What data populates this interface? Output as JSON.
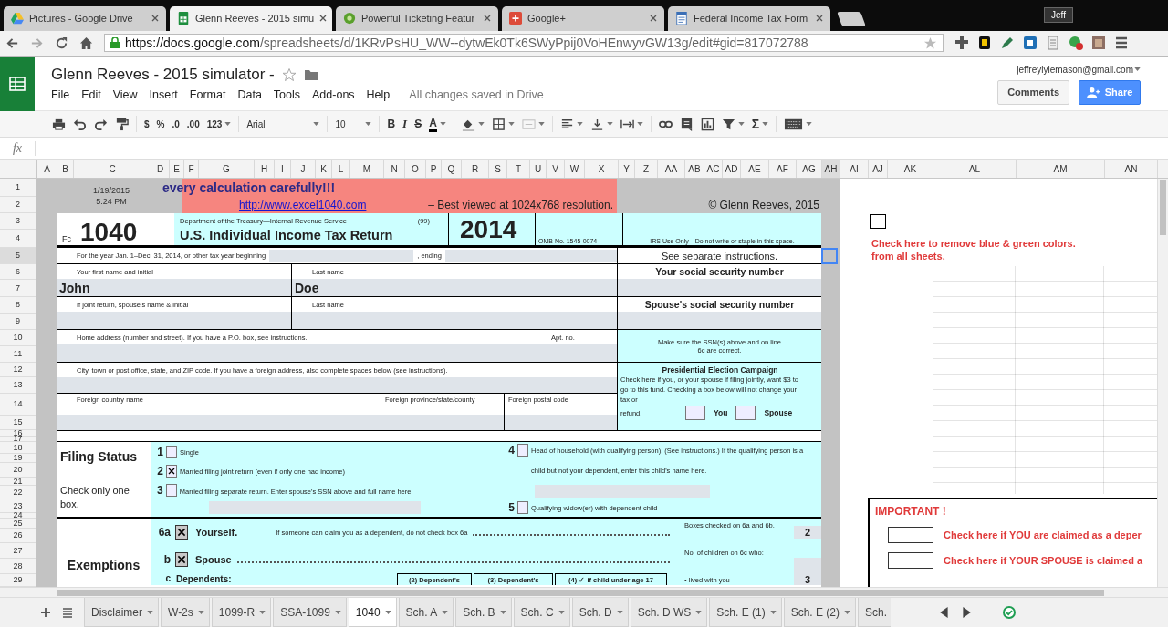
{
  "browser": {
    "tabs": [
      {
        "title": "Pictures - Google Drive",
        "selected": false
      },
      {
        "title": "Glenn Reeves - 2015 simu",
        "selected": true
      },
      {
        "title": "Powerful Ticketing Featur",
        "selected": false
      },
      {
        "title": "Google+",
        "selected": false
      },
      {
        "title": "Federal Income Tax Form",
        "selected": false
      }
    ],
    "profile": "Jeff",
    "url_host": "https://docs.google.com",
    "url_path": "/spreadsheets/d/1KRvPsHU_WW--dytwEk0Tk6SWyPpij0VoHEnwyvGW13g/edit#gid=817072788"
  },
  "docs": {
    "title": "Glenn Reeves - 2015 simulator -",
    "menu": [
      "File",
      "Edit",
      "View",
      "Insert",
      "Format",
      "Data",
      "Tools",
      "Add-ons",
      "Help"
    ],
    "save_status": "All changes saved in Drive",
    "account": "jeffreylylemason@gmail.com",
    "comments": "Comments",
    "share": "Share"
  },
  "toolbar": {
    "currency": "$",
    "percent": "%",
    "decrease_decimals": ".0",
    "increase_decimals": ".00",
    "more_formats": "123",
    "font": "Arial",
    "font_size": "10",
    "bold": "B",
    "italic": "I",
    "strike": "S",
    "text_color": "A",
    "functions": "Σ"
  },
  "formula_bar": {
    "label": "fx"
  },
  "sheet": {
    "columns": [
      {
        "label": "A",
        "selected": false
      },
      {
        "label": "B",
        "selected": false
      },
      {
        "label": "C",
        "selected": false
      },
      {
        "label": "D",
        "selected": false
      },
      {
        "label": "E",
        "selected": false
      },
      {
        "label": "F",
        "selected": false
      },
      {
        "label": "G",
        "selected": false
      },
      {
        "label": "H",
        "selected": false
      },
      {
        "label": "I",
        "selected": false
      },
      {
        "label": "J",
        "selected": false
      },
      {
        "label": "K",
        "selected": false
      },
      {
        "label": "L",
        "selected": false
      },
      {
        "label": "M",
        "selected": false
      },
      {
        "label": "N",
        "selected": false
      },
      {
        "label": "O",
        "selected": false
      },
      {
        "label": "P",
        "selected": false
      },
      {
        "label": "Q",
        "selected": false
      },
      {
        "label": "R",
        "selected": false
      },
      {
        "label": "S",
        "selected": false
      },
      {
        "label": "T",
        "selected": false
      },
      {
        "label": "U",
        "selected": false
      },
      {
        "label": "V",
        "selected": false
      },
      {
        "label": "W",
        "selected": false
      },
      {
        "label": "X",
        "selected": false
      },
      {
        "label": "Y",
        "selected": false
      },
      {
        "label": "Z",
        "selected": false
      },
      {
        "label": "AA",
        "selected": false
      },
      {
        "label": "AB",
        "selected": false
      },
      {
        "label": "AC",
        "selected": false
      },
      {
        "label": "AD",
        "selected": false
      },
      {
        "label": "AE",
        "selected": false
      },
      {
        "label": "AF",
        "selected": false
      },
      {
        "label": "AG",
        "selected": false
      },
      {
        "label": "AH",
        "selected": true
      },
      {
        "label": "AI",
        "selected": false
      },
      {
        "label": "AJ",
        "selected": false
      },
      {
        "label": "AK",
        "selected": false
      },
      {
        "label": "AL",
        "selected": false
      },
      {
        "label": "AM",
        "selected": false
      },
      {
        "label": "AN",
        "selected": false
      }
    ],
    "rows": [
      {
        "label": "1",
        "selected": false
      },
      {
        "label": "2",
        "selected": false
      },
      {
        "label": "3",
        "selected": false
      },
      {
        "label": "4",
        "selected": false
      },
      {
        "label": "5",
        "selected": true
      },
      {
        "label": "6",
        "selected": false
      },
      {
        "label": "7",
        "selected": false
      },
      {
        "label": "8",
        "selected": false
      },
      {
        "label": "9",
        "selected": false
      },
      {
        "label": "10",
        "selected": false
      },
      {
        "label": "11",
        "selected": false
      },
      {
        "label": "12",
        "selected": false
      },
      {
        "label": "13",
        "selected": false
      },
      {
        "label": "14",
        "selected": false
      },
      {
        "label": "15",
        "selected": false
      },
      {
        "label": "16",
        "selected": false
      },
      {
        "label": "17",
        "selected": false
      },
      {
        "label": "18",
        "selected": false
      },
      {
        "label": "19",
        "selected": false
      },
      {
        "label": "20",
        "selected": false
      },
      {
        "label": "21",
        "selected": false
      },
      {
        "label": "22",
        "selected": false
      },
      {
        "label": "23",
        "selected": false
      },
      {
        "label": "24",
        "selected": false
      },
      {
        "label": "25",
        "selected": false
      },
      {
        "label": "26",
        "selected": false
      },
      {
        "label": "27",
        "selected": false
      },
      {
        "label": "28",
        "selected": false
      },
      {
        "label": "29",
        "selected": false
      }
    ]
  },
  "form": {
    "banner": {
      "date": "1/19/2015",
      "time": "5:24 PM",
      "heading": "every calculation carefully!!!",
      "link": "http://www.excel1040.com",
      "note": "– Best viewed at 1024x768 resolution.",
      "copyright": "© Glenn Reeves, 2015"
    },
    "header": {
      "form_prefix": "Fc",
      "form_number": "1040",
      "department": "Department of the Treasury—Internal Revenue Service",
      "code": "(99)",
      "title": "U.S. Individual Income Tax Return",
      "year": "2014",
      "omb": "OMB No. 1545-0074",
      "irs_note": "IRS Use Only—Do not write or staple in this space."
    },
    "tax_year": {
      "label": "For the year Jan. 1–Dec. 31, 2014, or other tax year beginning",
      "ending": ", ending",
      "instructions": "See separate instructions."
    },
    "name_rows": [
      {
        "first_label": "Your first name and initial",
        "first_value": "John",
        "last_label": "Last name",
        "last_value": "Doe",
        "ssn_label": "Your social security number"
      },
      {
        "first_label": "If joint return, spouse's name & initial",
        "last_label": "Last name",
        "ssn_label": "Spouse's social security number"
      }
    ],
    "address": {
      "label": "Home address (number and street). If you have a P.O. box, see instructions.",
      "apt_label": "Apt. no.",
      "ssn_note": "Make sure the SSN(s) above and on line 6c are correct."
    },
    "city": {
      "label": "City, town or post office, state, and ZIP code. If you have a foreign address, also complete spaces below (see instructions)."
    },
    "foreign": [
      "Foreign country name",
      "Foreign province/state/county",
      "Foreign postal code"
    ],
    "campaign": {
      "title": "Presidential Election Campaign",
      "text": "Check here if you, or your spouse if filing jointly, want $3 to go to this fund. Checking a box below will not change your tax or",
      "last_word": "refund.",
      "boxes": [
        {
          "label": "You",
          "checked": false
        },
        {
          "label": "Spouse",
          "checked": false
        }
      ]
    },
    "filing_status": {
      "title": "Filing Status",
      "hint": "Check only one box.",
      "left_items": [
        {
          "number": "1",
          "label": "Single",
          "checked": false,
          "kind": "plain"
        },
        {
          "number": "2",
          "label": "Married filing joint return (even if only one had income)",
          "checked": true,
          "kind": "plain"
        },
        {
          "number": "3",
          "label": "Married filing separate return.  Enter spouse's SSN above and full name here.",
          "checked": false,
          "kind": "name_field"
        }
      ],
      "right_items": [
        {
          "number": "4",
          "label": "Head of household (with qualifying person). (See instructions.) If the qualifying person is a child but not your dependent, enter this child's name here.",
          "checked": false,
          "kind": "name_field"
        },
        {
          "number": "5",
          "label": "Qualifying widow(er) with dependent child",
          "checked": false,
          "kind": "plain"
        }
      ]
    },
    "exemptions": {
      "title": "Exemptions",
      "lines": [
        {
          "number": "6a",
          "label": "Yourself.",
          "note": "If someone can claim you as a dependent, do not check box 6a",
          "checked": true,
          "side_note": "Boxes checked on 6a and 6b.",
          "count": "2"
        },
        {
          "number": "b",
          "label": "Spouse",
          "checked": true,
          "side_note": "No. of children on 6c who:"
        }
      ],
      "dependents": {
        "number": "c",
        "label": "Dependents:",
        "columns": [
          "(2) Dependent's",
          "(3) Dependent's",
          "(4) ✓ if child under age 17"
        ],
        "side_note": "• lived with you",
        "count": "3"
      }
    }
  },
  "side_panel": {
    "remove_colors": {
      "checked": false,
      "lines": [
        "Check here to remove blue & green colors.",
        "from all sheets."
      ]
    },
    "important": {
      "title": "IMPORTANT !",
      "items": [
        {
          "label": "Check here if YOU are claimed as a deper",
          "checked": false
        },
        {
          "label": "Check here if YOUR SPOUSE is claimed a",
          "checked": false
        }
      ]
    }
  },
  "sheet_tabs": [
    {
      "label": "Disclaimer",
      "selected": false
    },
    {
      "label": "W-2s",
      "selected": false
    },
    {
      "label": "1099-R",
      "selected": false
    },
    {
      "label": "SSA-1099",
      "selected": false
    },
    {
      "label": "1040",
      "selected": true
    },
    {
      "label": "Sch. A",
      "selected": false
    },
    {
      "label": "Sch. B",
      "selected": false
    },
    {
      "label": "Sch. C",
      "selected": false
    },
    {
      "label": "Sch. D",
      "selected": false
    },
    {
      "label": "Sch. D WS",
      "selected": false
    },
    {
      "label": "Sch. E (1)",
      "selected": false
    },
    {
      "label": "Sch. E (2)",
      "selected": false
    },
    {
      "label": "Sch.",
      "selected": false,
      "partial": true
    }
  ]
}
